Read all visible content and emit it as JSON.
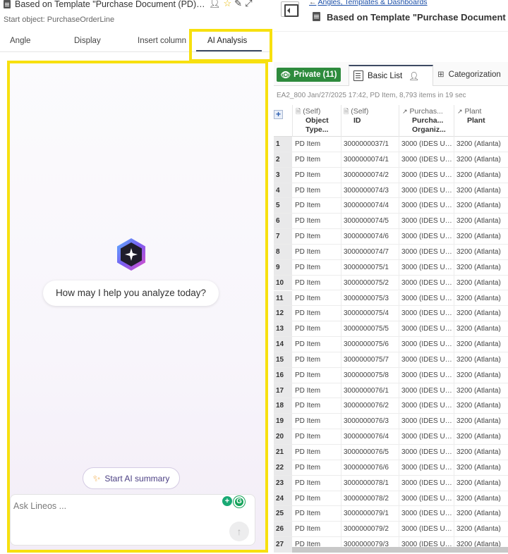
{
  "left_panel": {
    "title": "Based on Template \"Purchase Document (PD) Items\"",
    "start_object": "Start object: PurchaseOrderLine",
    "tabs": [
      {
        "label": "Angle"
      },
      {
        "label": "Display"
      },
      {
        "label": "Insert column"
      },
      {
        "label": "AI Analysis",
        "active": true
      }
    ],
    "ai": {
      "greeting": "How may I help you analyze today?",
      "summary_button": "Start AI summary",
      "chat_placeholder": "Ask Lineos ..."
    }
  },
  "right_panel": {
    "breadcrumb": "Angles, Templates & Dashboards",
    "title": "Based on Template \"Purchase Document (PD)",
    "toolbar": {
      "private_label": "Private (11)",
      "basic_list_label": "Basic List",
      "categorization_label": "Categorization"
    },
    "info": "EA2_800 Jan/27/2025 17:42, PD Item, 8,793 items in 19 sec",
    "columns": [
      {
        "prefix": "(Self)",
        "label1": "Object",
        "label2": "Type..."
      },
      {
        "prefix": "(Self)",
        "label1": "ID",
        "label2": ""
      },
      {
        "prefix": "Purchas...",
        "label1": "Purcha...",
        "label2": "Organiz..."
      },
      {
        "prefix": "Plant",
        "label1": "Plant",
        "label2": ""
      }
    ],
    "rows": [
      {
        "n": "1",
        "type": "PD Item",
        "id": "3000000037/1",
        "org": "3000 (IDES US...",
        "plant": "3200 (Atlanta)"
      },
      {
        "n": "2",
        "type": "PD Item",
        "id": "3000000074/1",
        "org": "3000 (IDES US...",
        "plant": "3200 (Atlanta)"
      },
      {
        "n": "3",
        "type": "PD Item",
        "id": "3000000074/2",
        "org": "3000 (IDES US...",
        "plant": "3200 (Atlanta)"
      },
      {
        "n": "4",
        "type": "PD Item",
        "id": "3000000074/3",
        "org": "3000 (IDES US...",
        "plant": "3200 (Atlanta)"
      },
      {
        "n": "5",
        "type": "PD Item",
        "id": "3000000074/4",
        "org": "3000 (IDES US...",
        "plant": "3200 (Atlanta)"
      },
      {
        "n": "6",
        "type": "PD Item",
        "id": "3000000074/5",
        "org": "3000 (IDES US...",
        "plant": "3200 (Atlanta)"
      },
      {
        "n": "7",
        "type": "PD Item",
        "id": "3000000074/6",
        "org": "3000 (IDES US...",
        "plant": "3200 (Atlanta)"
      },
      {
        "n": "8",
        "type": "PD Item",
        "id": "3000000074/7",
        "org": "3000 (IDES US...",
        "plant": "3200 (Atlanta)"
      },
      {
        "n": "9",
        "type": "PD Item",
        "id": "3000000075/1",
        "org": "3000 (IDES US...",
        "plant": "3200 (Atlanta)"
      },
      {
        "n": "10",
        "type": "PD Item",
        "id": "3000000075/2",
        "org": "3000 (IDES US...",
        "plant": "3200 (Atlanta)"
      },
      {
        "n": "11",
        "type": "PD Item",
        "id": "3000000075/3",
        "org": "3000 (IDES US...",
        "plant": "3200 (Atlanta)"
      },
      {
        "n": "12",
        "type": "PD Item",
        "id": "3000000075/4",
        "org": "3000 (IDES US...",
        "plant": "3200 (Atlanta)"
      },
      {
        "n": "13",
        "type": "PD Item",
        "id": "3000000075/5",
        "org": "3000 (IDES US...",
        "plant": "3200 (Atlanta)"
      },
      {
        "n": "14",
        "type": "PD Item",
        "id": "3000000075/6",
        "org": "3000 (IDES US...",
        "plant": "3200 (Atlanta)"
      },
      {
        "n": "15",
        "type": "PD Item",
        "id": "3000000075/7",
        "org": "3000 (IDES US...",
        "plant": "3200 (Atlanta)"
      },
      {
        "n": "16",
        "type": "PD Item",
        "id": "3000000075/8",
        "org": "3000 (IDES US...",
        "plant": "3200 (Atlanta)"
      },
      {
        "n": "17",
        "type": "PD Item",
        "id": "3000000076/1",
        "org": "3000 (IDES US...",
        "plant": "3200 (Atlanta)"
      },
      {
        "n": "18",
        "type": "PD Item",
        "id": "3000000076/2",
        "org": "3000 (IDES US...",
        "plant": "3200 (Atlanta)"
      },
      {
        "n": "19",
        "type": "PD Item",
        "id": "3000000076/3",
        "org": "3000 (IDES US...",
        "plant": "3200 (Atlanta)"
      },
      {
        "n": "20",
        "type": "PD Item",
        "id": "3000000076/4",
        "org": "3000 (IDES US...",
        "plant": "3200 (Atlanta)"
      },
      {
        "n": "21",
        "type": "PD Item",
        "id": "3000000076/5",
        "org": "3000 (IDES US...",
        "plant": "3200 (Atlanta)"
      },
      {
        "n": "22",
        "type": "PD Item",
        "id": "3000000076/6",
        "org": "3000 (IDES US...",
        "plant": "3200 (Atlanta)"
      },
      {
        "n": "23",
        "type": "PD Item",
        "id": "3000000078/1",
        "org": "3000 (IDES US...",
        "plant": "3200 (Atlanta)"
      },
      {
        "n": "24",
        "type": "PD Item",
        "id": "3000000078/2",
        "org": "3000 (IDES US...",
        "plant": "3200 (Atlanta)"
      },
      {
        "n": "25",
        "type": "PD Item",
        "id": "3000000079/1",
        "org": "3000 (IDES US...",
        "plant": "3200 (Atlanta)"
      },
      {
        "n": "26",
        "type": "PD Item",
        "id": "3000000079/2",
        "org": "3000 (IDES US...",
        "plant": "3200 (Atlanta)"
      },
      {
        "n": "27",
        "type": "PD Item",
        "id": "3000000079/3",
        "org": "3000 (IDES US...",
        "plant": "3200 (Atlanta)"
      }
    ]
  },
  "colors": {
    "highlight": "#f7e00f",
    "private_green": "#2e8b3d",
    "link_blue": "#1b4fa8",
    "tab_underline": "#3d4a63"
  },
  "icons": [
    "document-icon",
    "person-icon",
    "star-icon",
    "edit-icon",
    "expand-icon",
    "collapse-panel-icon",
    "eye-icon",
    "list-icon",
    "grid-icon",
    "sparkle-icon",
    "send-icon",
    "grammarly-icon",
    "add-column-icon"
  ]
}
